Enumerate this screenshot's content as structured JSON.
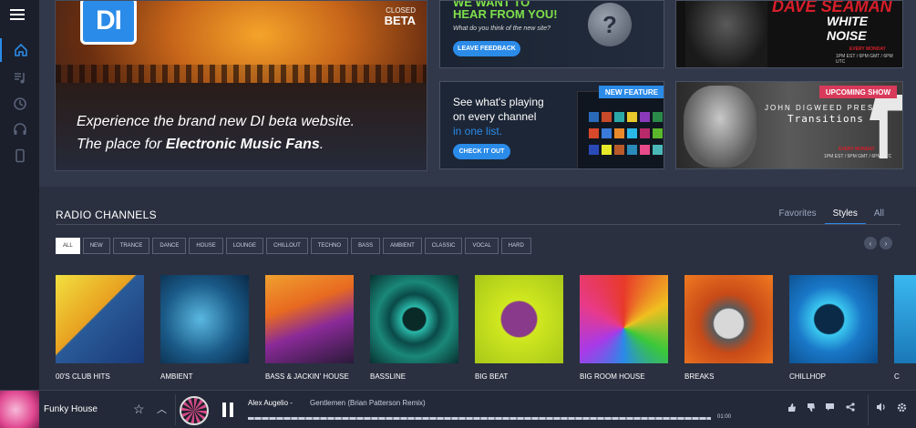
{
  "sidebar": {
    "items": [
      {
        "icon": "home-icon",
        "active": true
      },
      {
        "icon": "music-list-icon",
        "active": false
      },
      {
        "icon": "history-icon",
        "active": false
      },
      {
        "icon": "headphones-icon",
        "active": false
      },
      {
        "icon": "mobile-icon",
        "active": false
      }
    ]
  },
  "hero": {
    "logo": "DI",
    "closed_label": "CLOSED",
    "beta_label": "BETA",
    "line1": "Experience the brand new DI beta website.",
    "line2_prefix": "The place for ",
    "line2_bold": "Electronic Music Fans",
    "line2_suffix": "."
  },
  "feedback_card": {
    "line1": "WE WANT TO",
    "line2": "HEAR FROM YOU!",
    "question": "What do you think of the new site?",
    "button": "LEAVE FEEDBACK",
    "qmark": "?"
  },
  "white_noise_card": {
    "band": "DAVE SEAMAN",
    "show": "WHITE NOISE",
    "schedule": "EVERY MONDAY",
    "times": "1PM EST / 6PM GMT / 6PM UTC"
  },
  "feature_card": {
    "text1": "See what's playing",
    "text2": "on every channel",
    "text3": "in one list.",
    "button": "CHECK IT OUT",
    "badge": "NEW FEATURE"
  },
  "digweed_card": {
    "presents": "JOHN DIGWEED PRESENTS",
    "show": "Transitions",
    "badge": "UPCOMING SHOW",
    "schedule": "EVERY MONDAY",
    "times": "1PM EST / 5PM GMT / 6PM UTC"
  },
  "channels": {
    "title": "RADIO CHANNELS",
    "tabs": [
      "Favorites",
      "Styles",
      "All"
    ],
    "active_tab": "Styles",
    "filters": [
      "ALL",
      "NEW",
      "TRANCE",
      "DANCE",
      "HOUSE",
      "LOUNGE",
      "CHILLOUT",
      "TECHNO",
      "BASS",
      "AMBIENT",
      "CLASSIC",
      "VOCAL",
      "HARD"
    ],
    "active_filter": "ALL",
    "prev": "‹",
    "next": "›",
    "items": [
      {
        "name": "00'S CLUB HITS",
        "color": "#f2d020"
      },
      {
        "name": "AMBIENT",
        "color": "#2a7aa8"
      },
      {
        "name": "BASS & JACKIN' HOUSE",
        "color": "#e8902a"
      },
      {
        "name": "BASSLINE",
        "color": "#1a8a7a"
      },
      {
        "name": "BIG BEAT",
        "color": "#c8e020"
      },
      {
        "name": "BIG ROOM HOUSE",
        "color": "#a848d8"
      },
      {
        "name": "BREAKS",
        "color": "#e06818"
      },
      {
        "name": "CHILLHOP",
        "color": "#2aa8e8"
      },
      {
        "name": "C",
        "color": "#3ab8f0"
      }
    ]
  },
  "player": {
    "channel": "Funky House",
    "artist": "Alex Augelio",
    "separator": " - ",
    "track": "Gentlemen (Brian Patterson Remix)",
    "time": "01:00"
  }
}
